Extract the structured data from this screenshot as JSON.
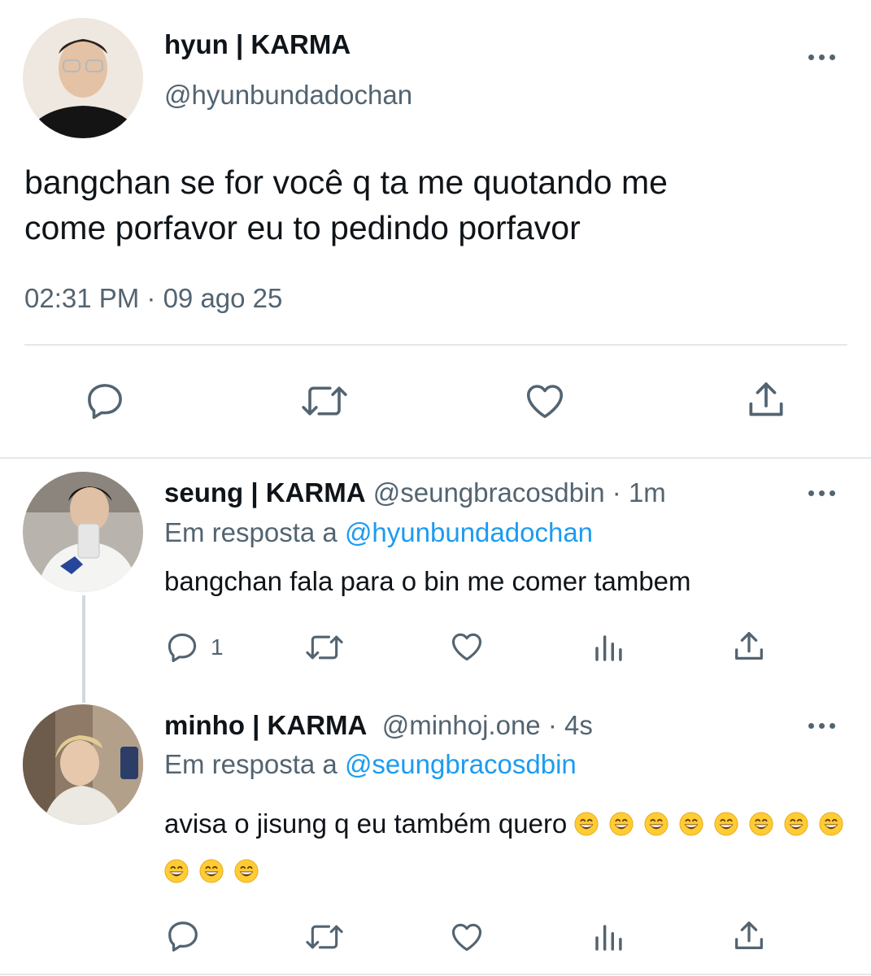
{
  "main_tweet": {
    "display_name": "hyun | KARMA",
    "handle": "@hyunbundadochan",
    "text_line1": "bangchan se for você q ta me quotando me",
    "text_line2": "come porfavor eu to pedindo porfavor",
    "timestamp": "02:31 PM · 09 ago 25"
  },
  "replies": [
    {
      "display_name": "seung | KARMA",
      "handle": "@seungbracosdbin",
      "time": "· 1m",
      "reply_prefix": "Em resposta a ",
      "reply_to": "@hyunbundadochan",
      "text": "bangchan fala para o bin me comer tambem",
      "reply_count": "1"
    },
    {
      "display_name": "minho | KARMA",
      "handle": "@minhoj.one",
      "time": "· 4s",
      "reply_prefix": "Em resposta a ",
      "reply_to": "@seungbracosdbin",
      "text": "avisa o jisung q eu também quero",
      "emoji_count": 11
    }
  ],
  "icons": {
    "reply": "reply-icon",
    "retweet": "retweet-icon",
    "like": "heart-icon",
    "share": "share-icon",
    "views": "analytics-icon",
    "more": "more-icon",
    "emoji": "grinning-face-emoji"
  },
  "colors": {
    "text": "#0f1419",
    "secondary": "#536471",
    "link": "#1d9bf0",
    "divider": "#e4e8eb",
    "thread_line": "#cfd9de"
  }
}
